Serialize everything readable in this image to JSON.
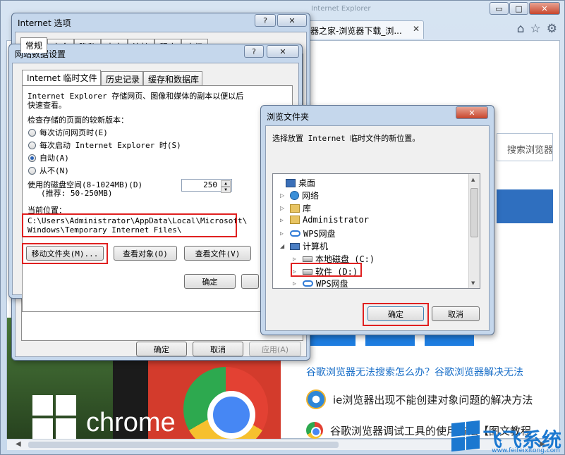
{
  "browser": {
    "tab_title": "览器之家-浏览器下载_浏...",
    "watermark": "Internet Explorer",
    "search_placeholder": "搜索浏览器",
    "article_headline": "谷歌浏览器无法搜索怎么办？谷歌浏览器解决无法",
    "list_items": [
      "ie浏览器出现不能创建对象问题的解决方法",
      "谷歌浏览器调试工具的使用方法【图文教程"
    ],
    "banner_text": "chrome",
    "site_logo_name": "飞飞系统",
    "site_logo_url": "www.feifeixitong.com",
    "ctrl_min": "▭",
    "ctrl_max": "□",
    "ctrl_close": "✕",
    "icons": [
      "home-icon",
      "star-icon",
      "gear-icon"
    ]
  },
  "internet_options": {
    "title": "Internet 选项",
    "ctrl_help": "?",
    "ctrl_close": "✕",
    "tabs": [
      "常规",
      "安全",
      "隐私",
      "内容",
      "连接",
      "程序",
      "高级"
    ],
    "buttons": {
      "ok": "确定",
      "cancel": "取消",
      "apply": "应用(A)"
    }
  },
  "website_data_settings": {
    "title": "网站数据设置",
    "ctrl_help": "?",
    "ctrl_close": "✕",
    "tabs": [
      "Internet 临时文件",
      "历史记录",
      "缓存和数据库"
    ],
    "description": "Internet Explorer 存储网页、图像和媒体的副本以便以后快速查看。",
    "description_line1": "Internet Explorer 存储网页、图像和媒体的副本以便以后",
    "description_line2": "快速查看。",
    "check_label": "检查存储的页面的较新版本：",
    "radio_options": [
      "每次访问网页时(E)",
      "每次启动 Internet Explorer 时(S)",
      "自动(A)",
      "从不(N)"
    ],
    "selected_option": "自动(A)",
    "disk_space_label": "使用的磁盘空间(8-1024MB)(D)",
    "disk_space_hint": "(推荐: 50-250MB)",
    "disk_space_value": "250",
    "current_location_label": "当前位置：",
    "current_location_line1": "C:\\Users\\Administrator\\AppData\\Local\\Microsoft\\",
    "current_location_line2": "Windows\\Temporary Internet Files\\",
    "buttons": {
      "move_folder": "移动文件夹(M)...",
      "view_objects": "查看对象(O)",
      "view_files": "查看文件(V)",
      "ok": "确定"
    }
  },
  "browse_folder": {
    "title": "浏览文件夹",
    "ctrl_close": "✕",
    "prompt": "选择放置 Internet 临时文件的新位置。",
    "tree": [
      {
        "label": "桌面",
        "icon": "desktop-icon",
        "expander": "",
        "level": 0
      },
      {
        "label": "网络",
        "icon": "network-icon",
        "expander": "▷",
        "level": 1
      },
      {
        "label": "库",
        "icon": "folder-icon",
        "expander": "▷",
        "level": 1
      },
      {
        "label": "Administrator",
        "icon": "user-folder-icon",
        "expander": "▷",
        "level": 1
      },
      {
        "label": "WPS网盘",
        "icon": "cloud-icon",
        "expander": "▷",
        "level": 1
      },
      {
        "label": "计算机",
        "icon": "computer-icon",
        "expander": "◢",
        "level": 1
      },
      {
        "label": "本地磁盘 (C:)",
        "icon": "drive-icon",
        "expander": "▷",
        "level": 2
      },
      {
        "label": "软件 (D:)",
        "icon": "drive-icon",
        "expander": "▷",
        "level": 2
      },
      {
        "label": "WPS网盘",
        "icon": "cloud-icon",
        "expander": "▷",
        "level": 2
      }
    ],
    "selected_item": "软件 (D:)",
    "buttons": {
      "ok": "确定",
      "cancel": "取消"
    }
  },
  "colors": {
    "highlight": "#e02020",
    "accent": "#1e7de0"
  }
}
